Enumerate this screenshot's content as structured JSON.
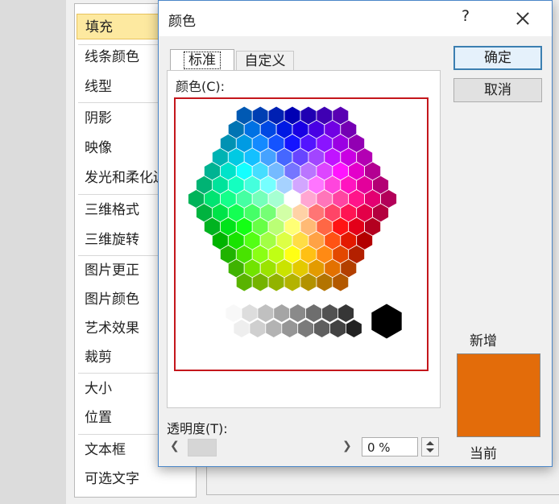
{
  "sidebar": {
    "items": [
      {
        "label": "填充",
        "selected": true
      },
      {
        "label": "线条颜色"
      },
      {
        "label": "线型"
      },
      {
        "label": "阴影"
      },
      {
        "label": "映像"
      },
      {
        "label": "发光和柔化边缘"
      },
      {
        "label": "三维格式"
      },
      {
        "label": "三维旋转"
      },
      {
        "label": "图片更正"
      },
      {
        "label": "图片颜色"
      },
      {
        "label": "艺术效果"
      },
      {
        "label": "裁剪"
      },
      {
        "label": "大小"
      },
      {
        "label": "位置"
      },
      {
        "label": "文本框"
      },
      {
        "label": "可选文字"
      }
    ]
  },
  "dialog": {
    "title": "颜色",
    "help_label": "?",
    "tabs": [
      {
        "label": "标准",
        "active": true
      },
      {
        "label": "自定义",
        "active": false
      }
    ],
    "colors_label": "颜色(C):",
    "transparency_label": "透明度(T):",
    "transparency_value": "0 %",
    "ok_label": "确定",
    "cancel_label": "取消",
    "new_label": "新增",
    "current_label": "当前",
    "new_color": "#e36c0a",
    "selection_outline_color": "#c4161c",
    "accent_color": "#3c7fb1"
  }
}
